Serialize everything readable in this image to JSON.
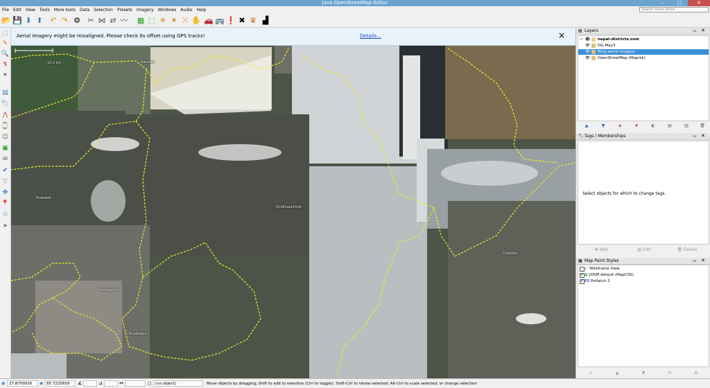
{
  "window": {
    "title": "Java OpenStreetMap Editor"
  },
  "menu": {
    "items": [
      "File",
      "Edit",
      "View",
      "Tools",
      "More tools",
      "Data",
      "Selection",
      "Presets",
      "Imagery",
      "Windows",
      "Audio",
      "Help"
    ],
    "search_placeholder": "Search menu items"
  },
  "notice": {
    "message": "Aerial imagery might be misaligned. Please check its offset using GPS tracks!",
    "link": "Details...",
    "close": "×"
  },
  "map": {
    "scale_label": "10.0 km",
    "places": [
      "Rasuwa",
      "Nuwakot",
      "Sindhupalchok",
      "Dolakha",
      "Kathmandu",
      "Bhaktapur"
    ]
  },
  "panels": {
    "layers": {
      "title": "Layers",
      "items": [
        {
          "name": "nepal-districts.osm",
          "active": true,
          "selected": false,
          "icon_color": "#e8d28a"
        },
        {
          "name": "DG-May3",
          "active": false,
          "selected": false,
          "icon_color": "#d8c27a"
        },
        {
          "name": "Bing aerial imagery",
          "active": false,
          "selected": true,
          "icon_color": "#d8c27a"
        },
        {
          "name": "OpenStreetMap (Mapnik)",
          "active": false,
          "selected": false,
          "icon_color": "#d8c27a"
        }
      ]
    },
    "tags": {
      "title": "Tags / Memberships",
      "empty_message": "Select objects for which to change tags.",
      "add": "Add",
      "edit": "Edit",
      "delete": "Delete"
    },
    "styles": {
      "title": "Map Paint Styles",
      "items": [
        {
          "name": "Wireframe View",
          "checked": false
        },
        {
          "name": "JOSM default (MapCSS)",
          "checked": true
        },
        {
          "name": "Potlatch 2",
          "checked": true
        }
      ]
    }
  },
  "status": {
    "lat": "27.8750016",
    "lon": "85.7225659",
    "selection": "(no object)",
    "hint": "Move objects by dragging; Shift to add to selection (Ctrl to toggle); Shift-Ctrl to rotate selected; Alt-Ctrl to scale selected; or change selection"
  },
  "colors": {
    "accent": "#6aa3cf",
    "selection": "#3c8fd6",
    "track": "#f2ef2a"
  }
}
